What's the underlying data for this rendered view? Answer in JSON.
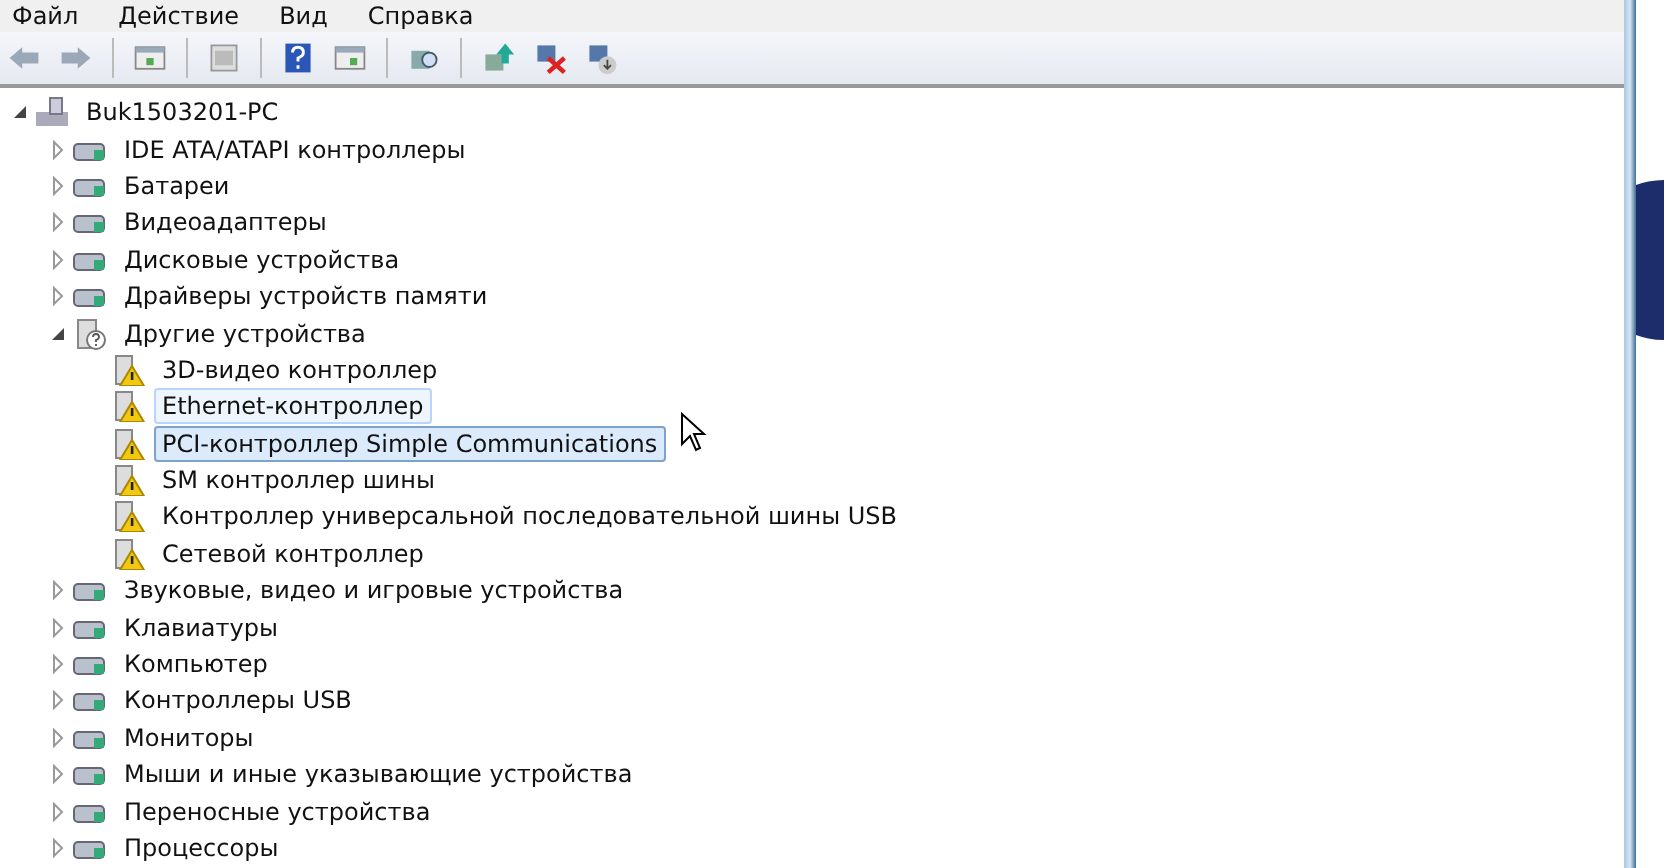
{
  "menu": [
    "Файл",
    "Действие",
    "Вид",
    "Справка"
  ],
  "tree": {
    "label": "Buk1503201-PC",
    "kind": "computer",
    "expanded": true,
    "children": [
      {
        "label": "IDE ATA/ATAPI контроллеры",
        "kind": "group",
        "expanded": false
      },
      {
        "label": "Батареи",
        "kind": "group",
        "expanded": false
      },
      {
        "label": "Видеоадаптеры",
        "kind": "group",
        "expanded": false
      },
      {
        "label": "Дисковые устройства",
        "kind": "group",
        "expanded": false
      },
      {
        "label": "Драйверы устройств памяти",
        "kind": "group",
        "expanded": false
      },
      {
        "label": "Другие устройства",
        "kind": "unknown-group",
        "expanded": true,
        "children": [
          {
            "label": "3D-видео контроллер",
            "kind": "warning-device",
            "selected": false,
            "hovered": false
          },
          {
            "label": "Ethernet-контроллер",
            "kind": "warning-device",
            "selected": false,
            "hovered": true
          },
          {
            "label": "PCI-контроллер Simple Communications",
            "kind": "warning-device",
            "selected": true,
            "hovered": false
          },
          {
            "label": "SM контроллер шины",
            "kind": "warning-device",
            "selected": false,
            "hovered": false
          },
          {
            "label": "Контроллер универсальной последовательной шины USB",
            "kind": "warning-device",
            "selected": false,
            "hovered": false
          },
          {
            "label": "Сетевой контроллер",
            "kind": "warning-device",
            "selected": false,
            "hovered": false
          }
        ]
      },
      {
        "label": "Звуковые, видео и игровые устройства",
        "kind": "group",
        "expanded": false
      },
      {
        "label": "Клавиатуры",
        "kind": "group",
        "expanded": false
      },
      {
        "label": "Компьютер",
        "kind": "group",
        "expanded": false
      },
      {
        "label": "Контроллеры USB",
        "kind": "group",
        "expanded": false
      },
      {
        "label": "Мониторы",
        "kind": "group",
        "expanded": false
      },
      {
        "label": "Мыши и иные указывающие устройства",
        "kind": "group",
        "expanded": false
      },
      {
        "label": "Переносные устройства",
        "kind": "group",
        "expanded": false
      },
      {
        "label": "Процессоры",
        "kind": "group",
        "expanded": false
      }
    ]
  }
}
